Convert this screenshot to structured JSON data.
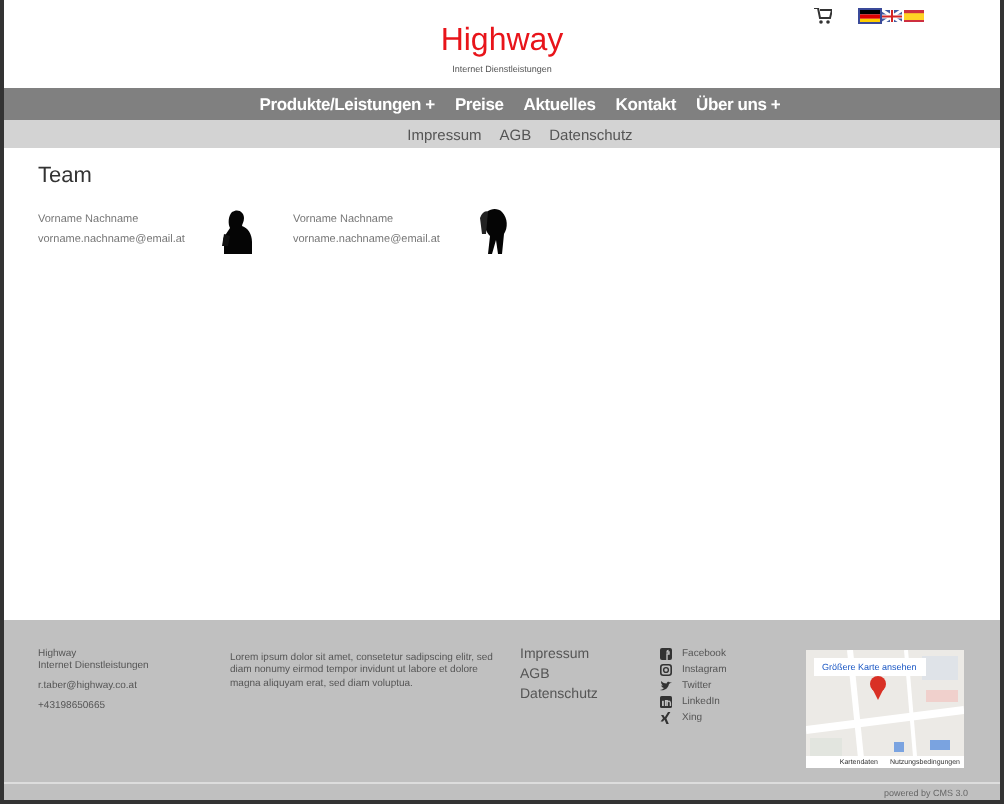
{
  "header": {
    "title": "Highway",
    "subtitle": "Internet Dienstleistungen",
    "languages": [
      {
        "kind": "de",
        "selected": true
      },
      {
        "kind": "en",
        "selected": false
      },
      {
        "kind": "es",
        "selected": false
      }
    ]
  },
  "nav": [
    {
      "label": "Produkte/Leistungen",
      "marker": "+"
    },
    {
      "label": "Preise"
    },
    {
      "label": "Aktuelles"
    },
    {
      "label": "Kontakt"
    },
    {
      "label": "Über uns",
      "marker": "+"
    }
  ],
  "subnav": [
    "Impressum",
    "AGB",
    "Datenschutz"
  ],
  "team": {
    "heading": "Team",
    "members": [
      {
        "name": "Vorname Nachname",
        "email": "vorname.nachname@email.at",
        "kind": "phone"
      },
      {
        "name": "Vorname Nachname",
        "email": "vorname.nachname@email.at",
        "kind": "bent"
      }
    ]
  },
  "footer": {
    "company": [
      "Highway",
      "Internet Dienstleistungen"
    ],
    "email": "r.taber@highway.co.at",
    "phone": "+43198650665",
    "text": "Lorem ipsum dolor sit amet, consetetur sadipscing elitr, sed diam nonumy eirmod tempor invidunt ut labore et dolore magna aliquyam erat, sed diam voluptua.",
    "links": [
      "Impressum",
      "AGB",
      "Datenschutz"
    ],
    "social": [
      {
        "kind": "facebook",
        "label": "Facebook"
      },
      {
        "kind": "instagram",
        "label": "Instagram"
      },
      {
        "kind": "twitter",
        "label": "Twitter"
      },
      {
        "kind": "linkedin",
        "label": "LinkedIn"
      },
      {
        "kind": "xing",
        "label": "Xing"
      }
    ],
    "map": {
      "link": "Größere Karte ansehen",
      "attribution": [
        "Kartendaten",
        "Nutzungsbedingungen"
      ]
    }
  },
  "powered": "powered by CMS 3.0"
}
